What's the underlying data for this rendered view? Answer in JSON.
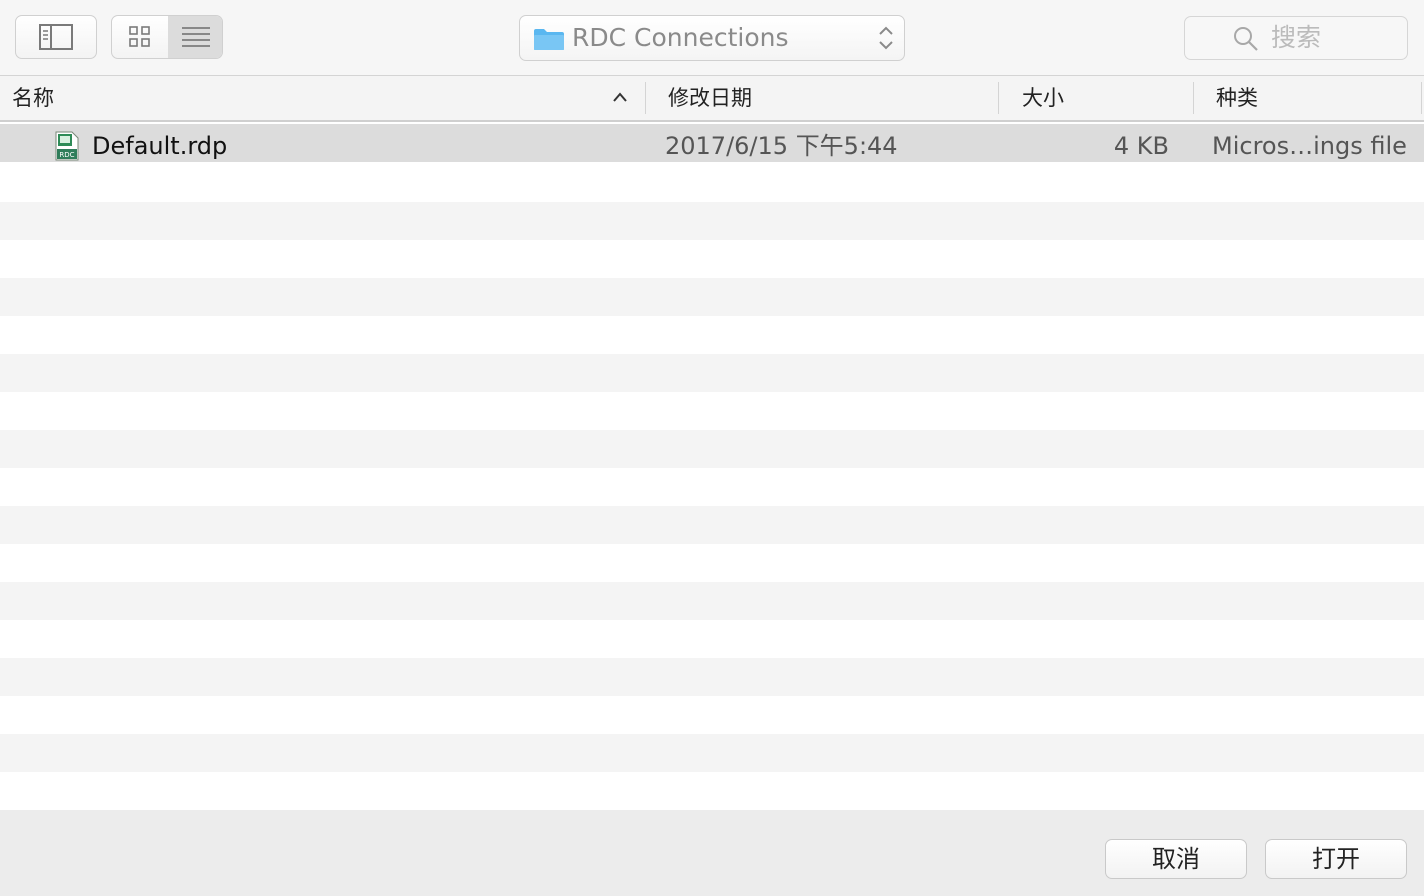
{
  "toolbar": {
    "location_label": "RDC Connections",
    "search_placeholder": "搜索"
  },
  "columns": {
    "name": "名称",
    "modified": "修改日期",
    "size": "大小",
    "kind": "种类"
  },
  "files": [
    {
      "name": "Default.rdp",
      "modified": "2017/6/15 下午5:44",
      "size": "4 KB",
      "kind": "Micros…ings file",
      "icon": "rdp-file-icon",
      "icon_label": "RDC"
    }
  ],
  "buttons": {
    "cancel": "取消",
    "open": "打开"
  },
  "colors": {
    "selection": "#dcdcdc",
    "folder": "#5ab7f0",
    "stripe": "#f4f4f4"
  }
}
